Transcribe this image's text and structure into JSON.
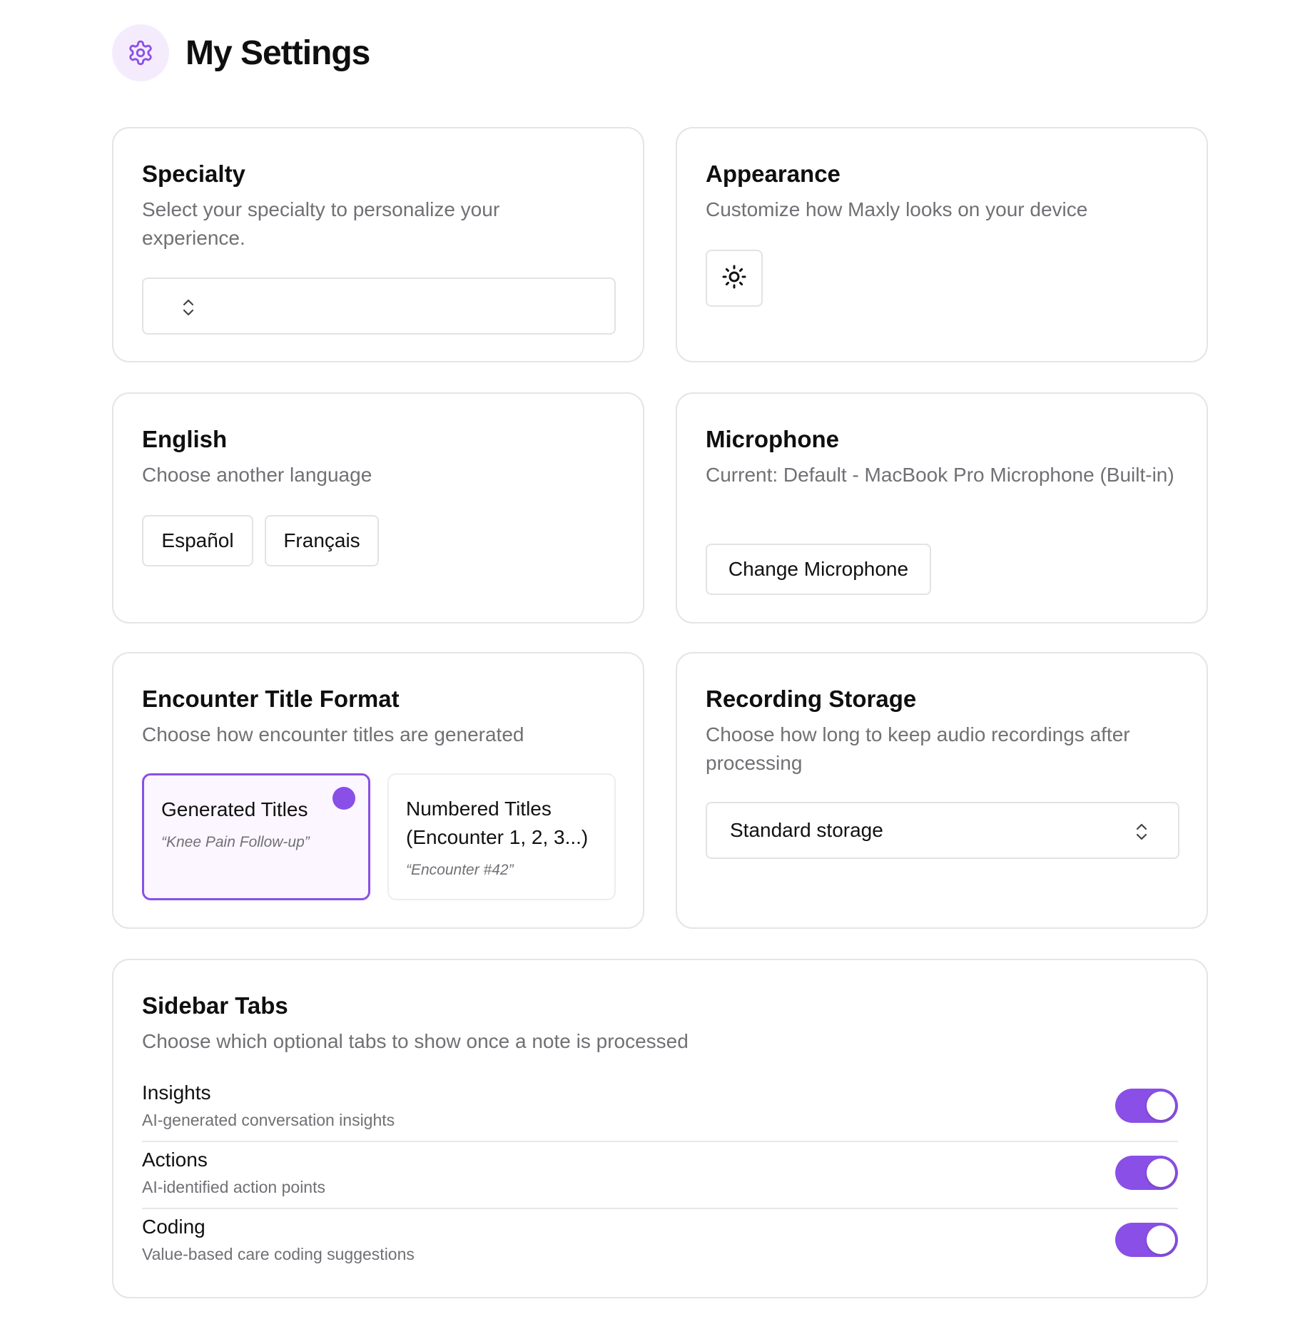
{
  "page": {
    "title": "My Settings",
    "icon": "gear-icon"
  },
  "colors": {
    "accent": "#8a4fe6",
    "accent_bg": "#f4ecfd",
    "muted_text": "#707075",
    "border": "#e5e5e8"
  },
  "specialty": {
    "title": "Specialty",
    "description": "Select your specialty to personalize your experience.",
    "select_value": "",
    "select_icon": "chevron-up-down-icon"
  },
  "appearance": {
    "title": "Appearance",
    "description": "Customize how Maxly looks on your device",
    "theme_icon": "sun-icon"
  },
  "language": {
    "title": "English",
    "description": "Choose another language",
    "options": [
      "Español",
      "Français"
    ]
  },
  "microphone": {
    "title": "Microphone",
    "description": "Current: Default - MacBook Pro Microphone (Built-in)",
    "button_label": "Change Microphone"
  },
  "encounter_title": {
    "title": "Encounter Title Format",
    "description": "Choose how encounter titles are generated",
    "options": [
      {
        "label": "Generated Titles",
        "example": "“Knee Pain Follow-up”",
        "selected": true
      },
      {
        "label": "Numbered Titles (Encounter 1, 2, 3...)",
        "example": "“Encounter #42”",
        "selected": false
      }
    ]
  },
  "recording_storage": {
    "title": "Recording Storage",
    "description": "Choose how long to keep audio recordings after processing",
    "select_value": "Standard storage",
    "select_icon": "chevron-up-down-icon"
  },
  "sidebar_tabs": {
    "title": "Sidebar Tabs",
    "description": "Choose which optional tabs to show once a note is processed",
    "items": [
      {
        "name": "Insights",
        "description": "AI-generated conversation insights",
        "enabled": true
      },
      {
        "name": "Actions",
        "description": "AI-identified action points",
        "enabled": true
      },
      {
        "name": "Coding",
        "description": "Value-based care coding suggestions",
        "enabled": true
      }
    ]
  }
}
